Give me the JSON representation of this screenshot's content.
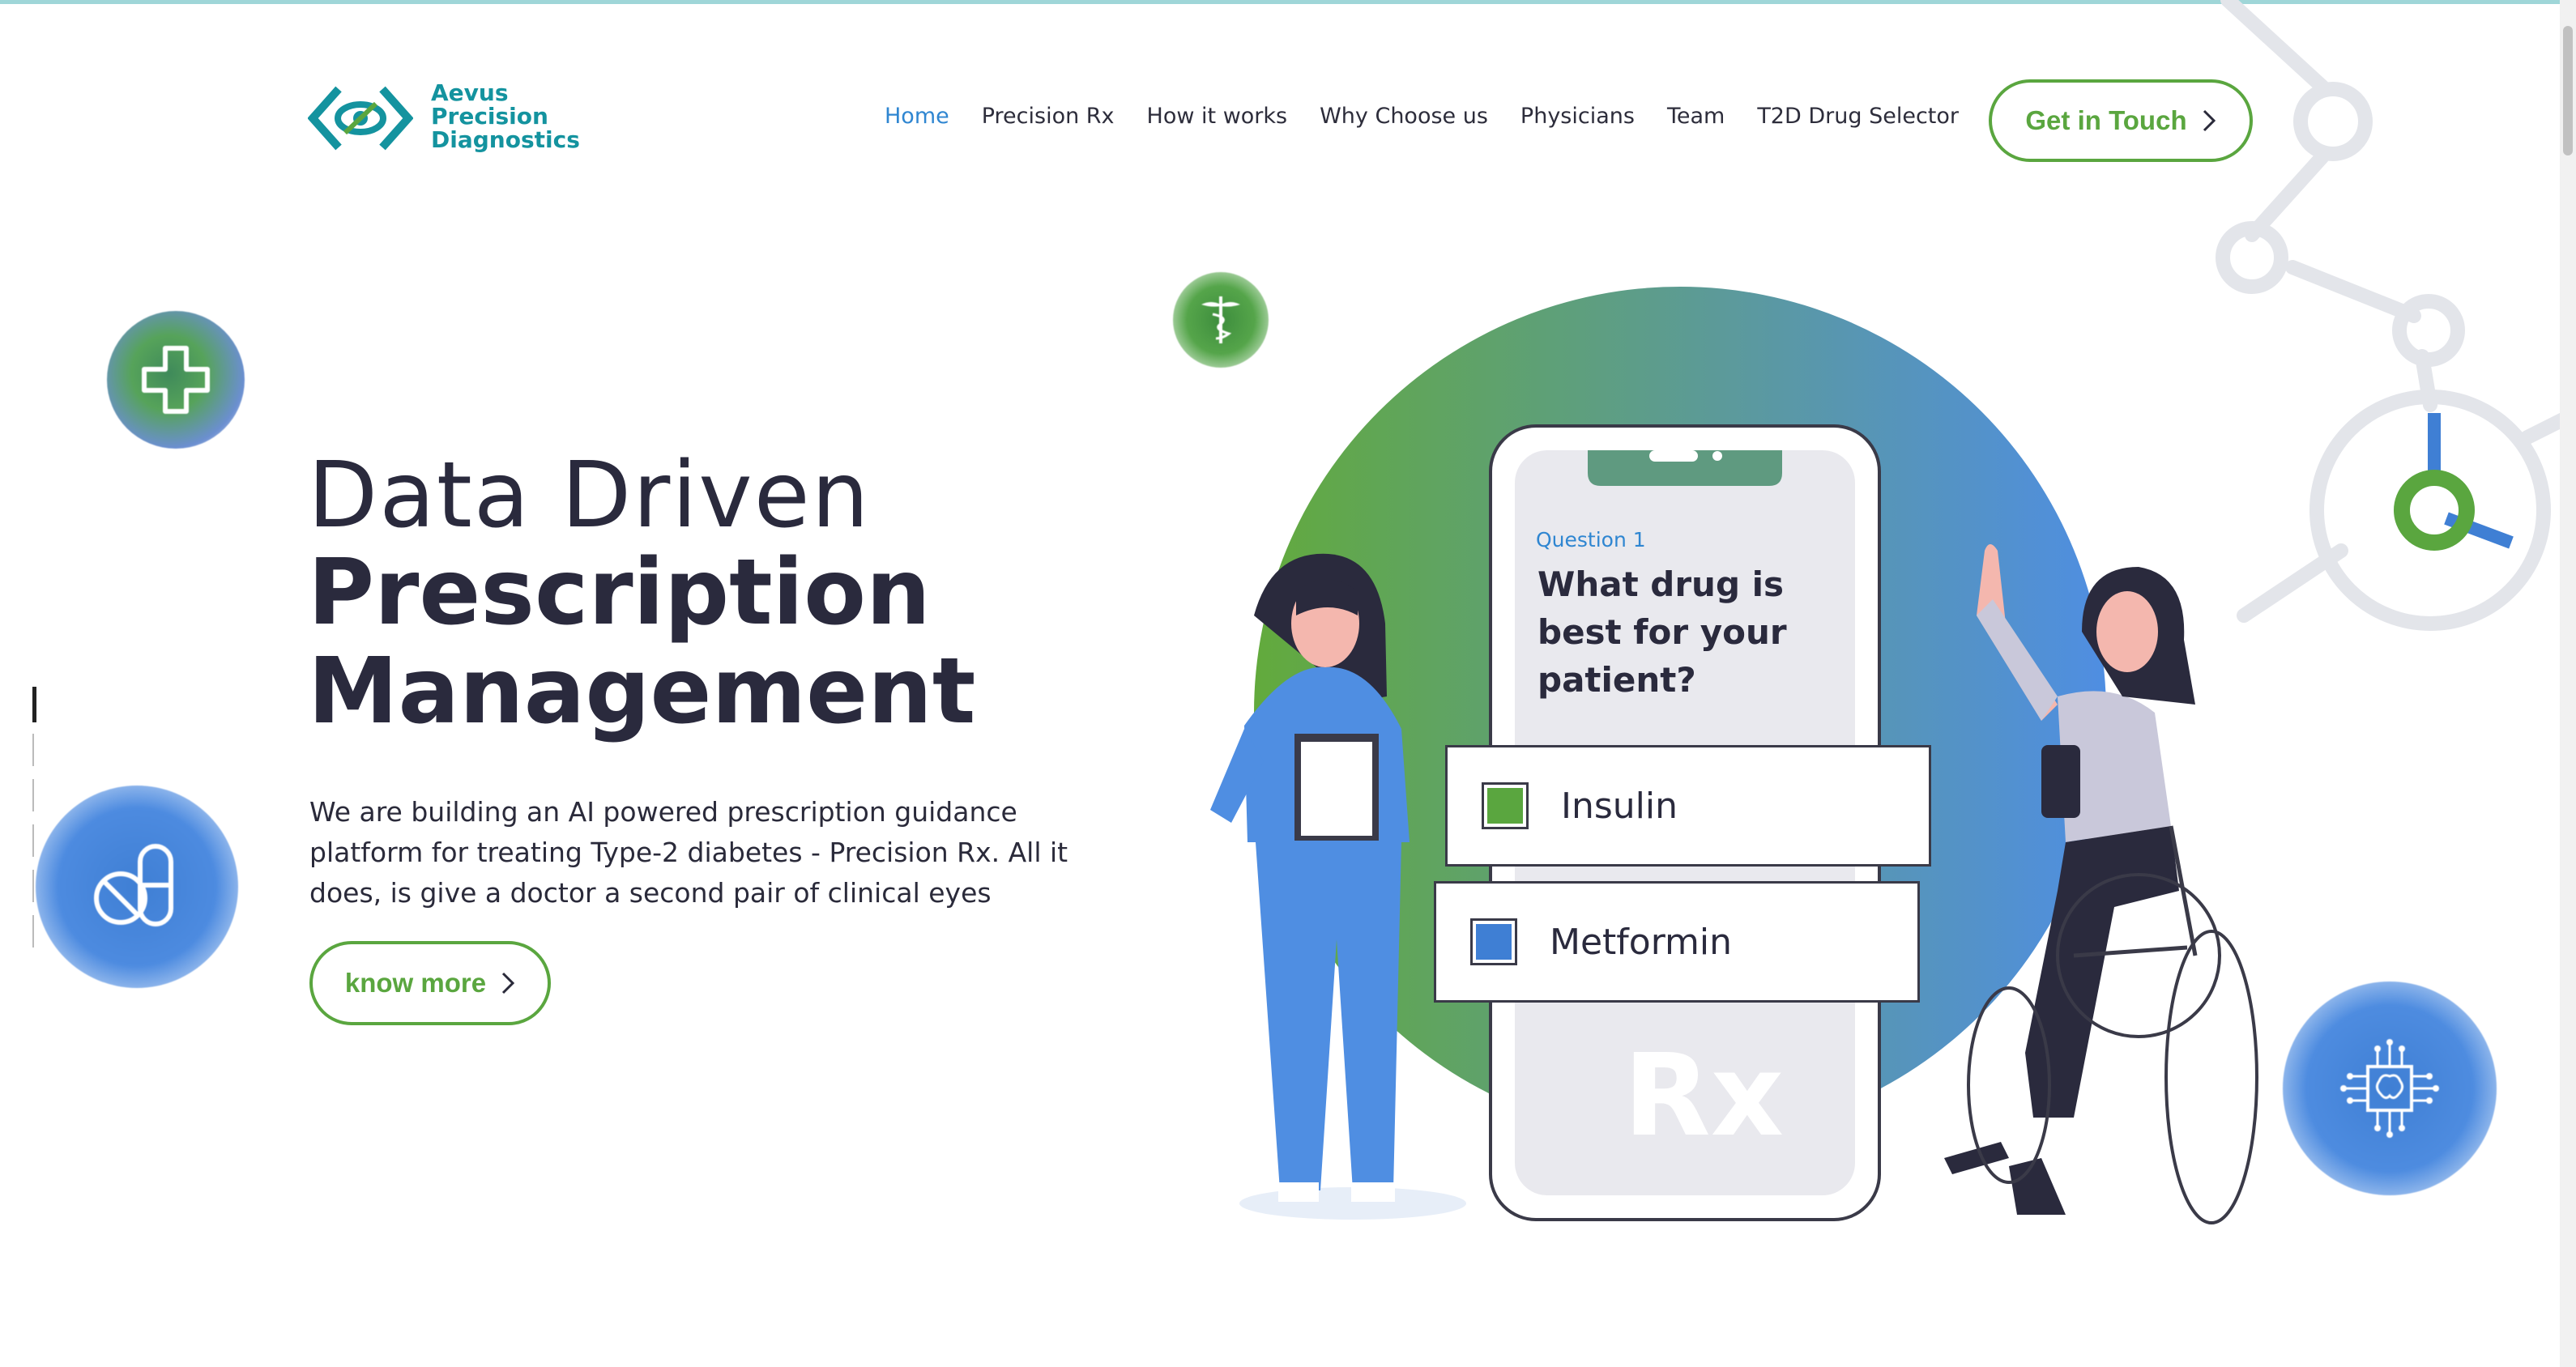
{
  "brand": {
    "name_lines": [
      "Aevus",
      "Precision",
      "Diagnostics"
    ],
    "color": "#14939f"
  },
  "nav": {
    "items": [
      {
        "label": "Home",
        "active": true
      },
      {
        "label": "Precision Rx",
        "active": false
      },
      {
        "label": "How it works",
        "active": false
      },
      {
        "label": "Why Choose us",
        "active": false
      },
      {
        "label": "Physicians",
        "active": false
      },
      {
        "label": "Team",
        "active": false
      },
      {
        "label": "T2D Drug Selector",
        "active": false
      }
    ],
    "cta_label": "Get in Touch"
  },
  "hero": {
    "title_light": "Data Driven",
    "title_bold_1": "Prescription",
    "title_bold_2": "Management",
    "intro": "We are building an AI powered prescription guidance platform for treating Type-2 diabetes - Precision Rx. All it does, is give a doctor a second pair of clinical eyes",
    "button_label": "know more"
  },
  "illustration": {
    "question_label": "Question 1",
    "question_text": "What drug is best for your patient?",
    "options": [
      {
        "label": "Insulin",
        "color": "#5aa63f"
      },
      {
        "label": "Metformin",
        "color": "#3f7fd4"
      }
    ],
    "rx_mark": "Rx"
  },
  "colors": {
    "accent_green": "#5aa63f",
    "accent_blue": "#2f86d1",
    "heading": "#2a2a3d"
  },
  "icons": [
    "plus-cross-icon",
    "caduceus-icon",
    "pill-icon",
    "brain-chip-icon",
    "chevron-right-icon"
  ]
}
